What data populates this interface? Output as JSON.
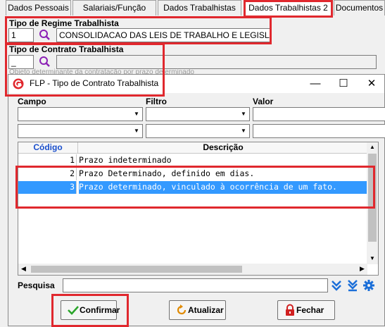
{
  "tabs": [
    {
      "label": "Dados Pessoais"
    },
    {
      "label": "Salariais/Função"
    },
    {
      "label": "Dados Trabalhistas"
    },
    {
      "label": "Dados Trabalhistas 2"
    },
    {
      "label": "Documentos"
    }
  ],
  "regime": {
    "label": "Tipo de Regime Trabalhista",
    "code": "1",
    "description": "CONSOLIDACAO DAS LEIS DE TRABALHO E LEGISLACOES"
  },
  "contrato": {
    "label": "Tipo de Contrato Trabalhista",
    "code": "_",
    "hint": "Objeto determinante da contratação por prazo determinado"
  },
  "dialog": {
    "title": "FLP - Tipo de Contrato Trabalhista",
    "filter_headers": {
      "campo": "Campo",
      "filtro": "Filtro",
      "valor": "Valor"
    },
    "grid_headers": {
      "code": "Código",
      "description": "Descrição"
    },
    "rows": [
      {
        "code": "1",
        "description": "Prazo indeterminado"
      },
      {
        "code": "2",
        "description": "Prazo Determinado, definido em dias."
      },
      {
        "code": "3",
        "description": "Prazo determinado, vinculado à ocorrência de um fato."
      }
    ],
    "search_label": "Pesquisa",
    "buttons": {
      "confirm": "Confirmar",
      "refresh": "Atualizar",
      "close": "Fechar"
    }
  },
  "colors": {
    "highlight": "#e0282e",
    "selection": "#3399ff",
    "accent_blue": "#1a6ed8"
  }
}
